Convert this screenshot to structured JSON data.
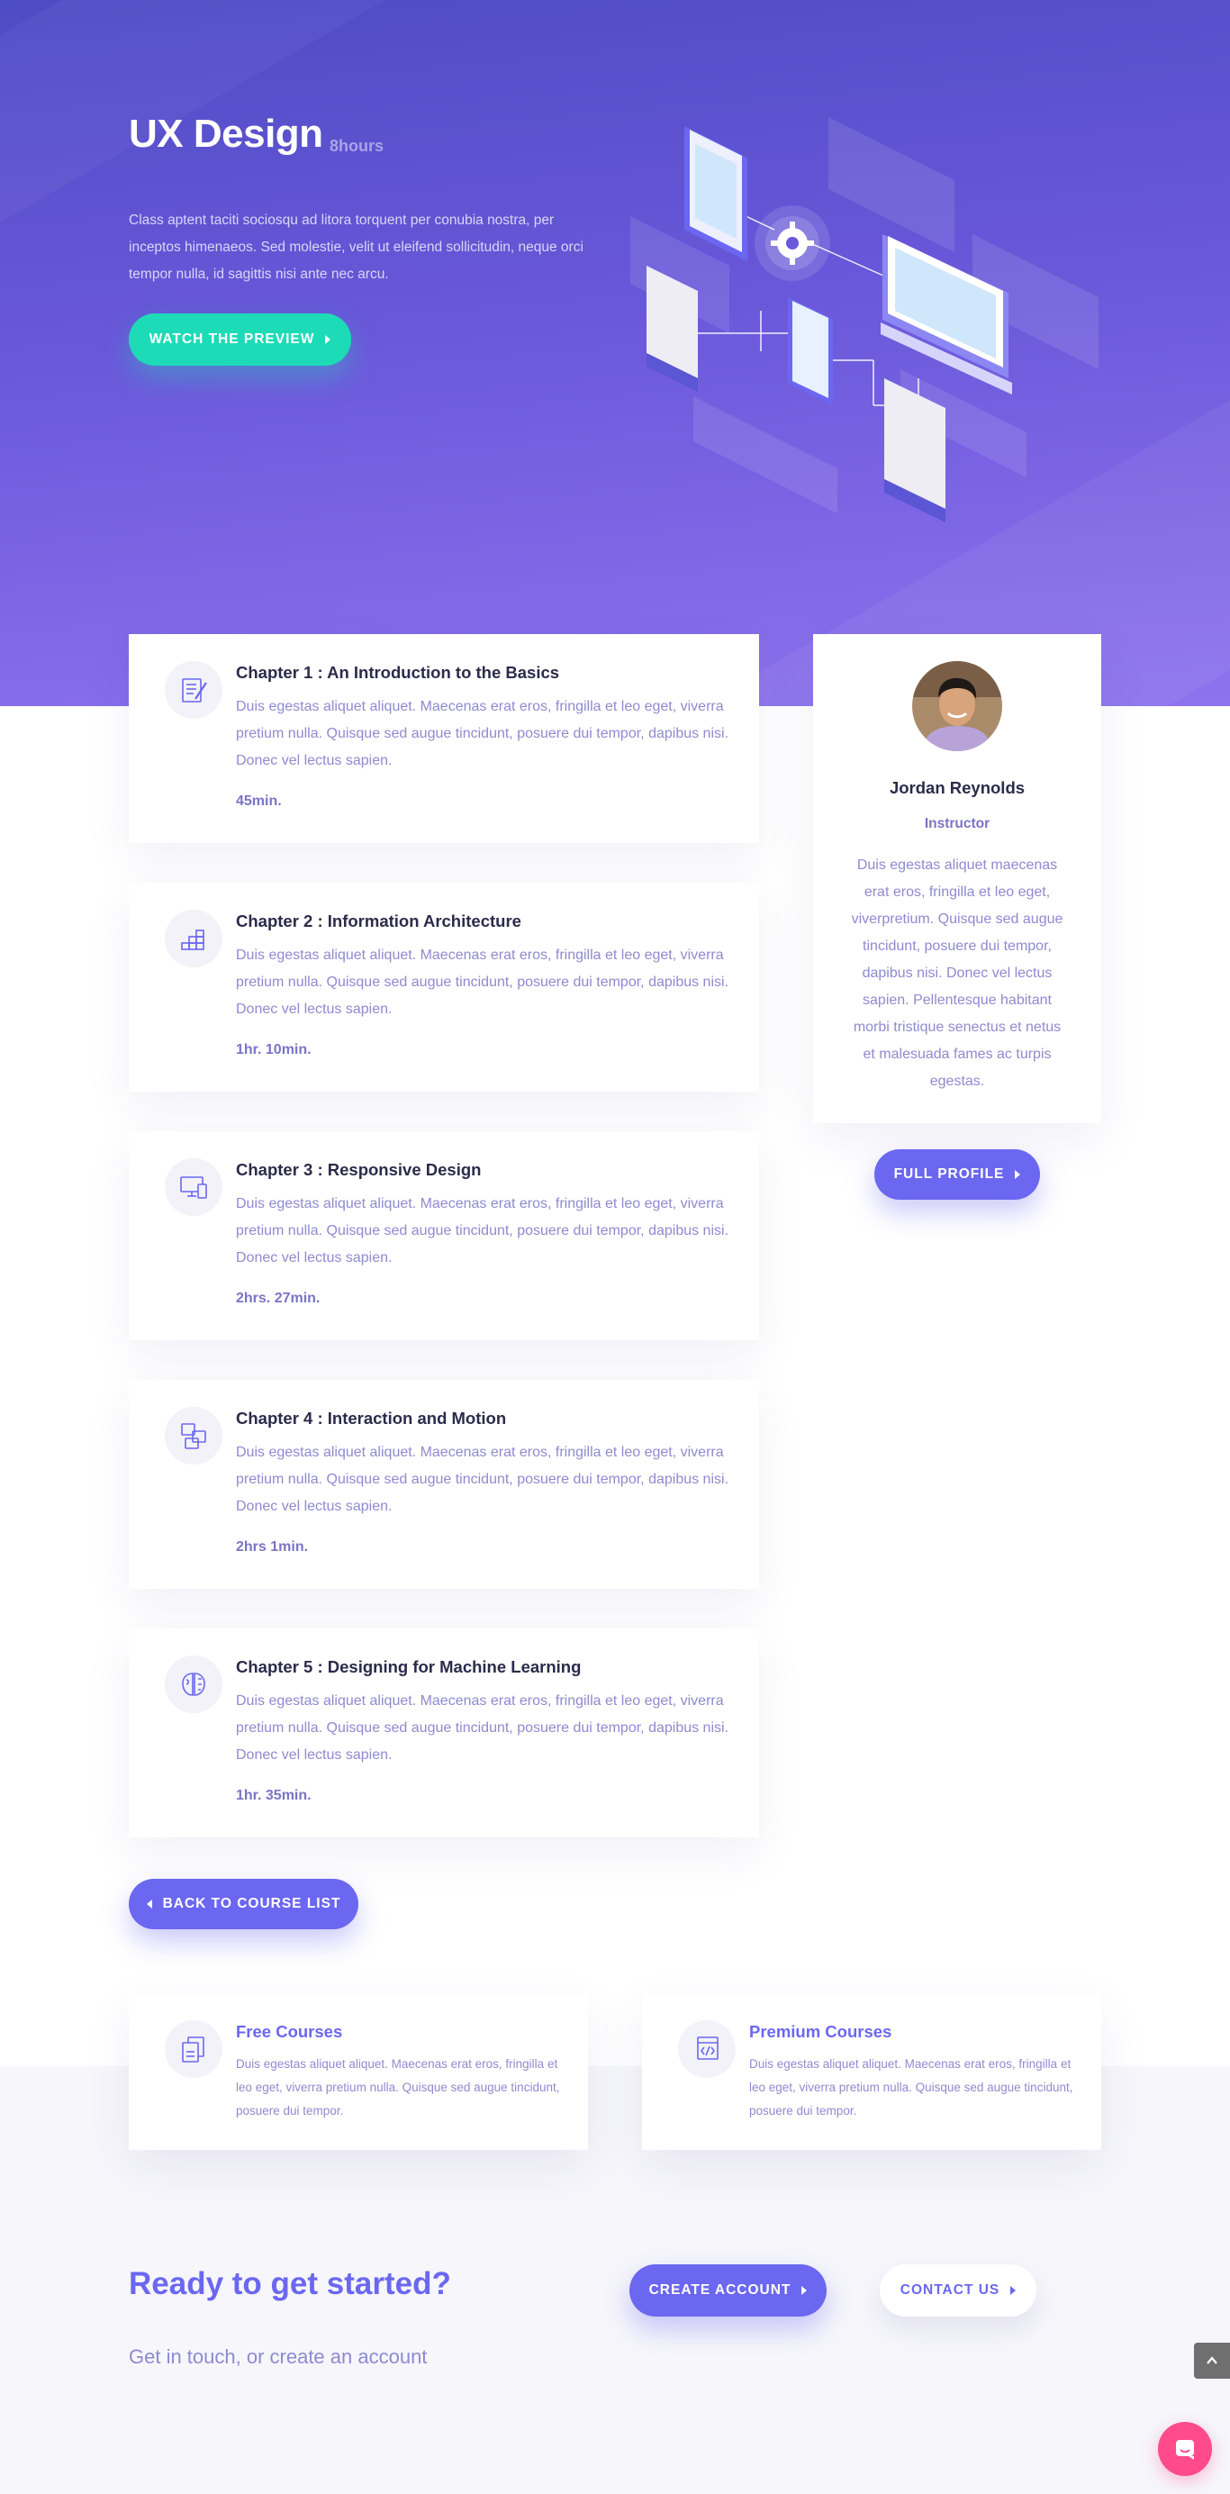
{
  "hero": {
    "title": "UX Design",
    "hours": "8hours",
    "description": "Class aptent taciti sociosqu ad litora torquent per conubia nostra, per inceptos himenaeos. Sed molestie, velit ut eleifend sollicitudin, neque orci tempor nulla, id sagittis nisi ante nec arcu.",
    "cta_label": "Watch the Preview"
  },
  "chapters": [
    {
      "title": "Chapter 1 : An Introduction to the Basics",
      "text": "Duis egestas aliquet aliquet. Maecenas erat eros, fringilla et leo eget, viverra pretium nulla. Quisque sed augue tincidunt, posuere dui tempor, dapibus nisi. Donec vel lectus sapien.",
      "duration": "45min.",
      "icon": "checklist-pencil-icon"
    },
    {
      "title": "Chapter 2 : Information Architecture",
      "text": "Duis egestas aliquet aliquet. Maecenas erat eros, fringilla et leo eget, viverra pretium nulla. Quisque sed augue tincidunt, posuere dui tempor, dapibus nisi. Donec vel lectus sapien.",
      "duration": "1hr. 10min.",
      "icon": "blocks-stack-icon"
    },
    {
      "title": "Chapter 3 : Responsive Design",
      "text": "Duis egestas aliquet aliquet. Maecenas erat eros, fringilla et leo eget, viverra pretium nulla. Quisque sed augue tincidunt, posuere dui tempor, dapibus nisi. Donec vel lectus sapien.",
      "duration": "2hrs. 27min.",
      "icon": "devices-icon"
    },
    {
      "title": "Chapter 4 : Interaction and Motion",
      "text": "Duis egestas aliquet aliquet. Maecenas erat eros, fringilla et leo eget, viverra pretium nulla. Quisque sed augue tincidunt, posuere dui tempor, dapibus nisi. Donec vel lectus sapien.",
      "duration": "2hrs 1min.",
      "icon": "interaction-icon"
    },
    {
      "title": "Chapter 5 : Designing for Machine Learning",
      "text": "Duis egestas aliquet aliquet. Maecenas erat eros, fringilla et leo eget, viverra pretium nulla. Quisque sed augue tincidunt, posuere dui tempor, dapibus nisi. Donec vel lectus sapien.",
      "duration": "1hr. 35min.",
      "icon": "brain-icon"
    }
  ],
  "instructor": {
    "name": "Jordan Reynolds",
    "role": "Instructor",
    "bio": "Duis egestas aliquet maecenas erat eros, fringilla et leo eget, viverpretium. Quisque sed augue tincidunt, posuere dui tempor, dapibus nisi. Donec vel lectus sapien. Pellentesque habitant morbi tristique senectus et netus et malesuada fames ac turpis egestas.",
    "profile_label": "Full Profile"
  },
  "back_label": "Back to Course List",
  "course_types": [
    {
      "title": "Free Courses",
      "text": "Duis egestas aliquet aliquet. Maecenas erat eros, fringilla et leo eget, viverra pretium nulla. Quisque sed augue tincidunt, posuere dui tempor.",
      "icon": "documents-icon"
    },
    {
      "title": "Premium Courses",
      "text": "Duis egestas aliquet aliquet. Maecenas erat eros, fringilla et leo eget, viverra pretium nulla. Quisque sed augue tincidunt, posuere dui tempor.",
      "icon": "code-window-icon"
    }
  ],
  "cta": {
    "title": "Ready to get started?",
    "subtitle": "Get in touch, or create an account",
    "create_label": "Create Account",
    "contact_label": "Contact Us"
  },
  "colors": {
    "accent": "#6b67f0",
    "teal": "#1ddbb6",
    "text_muted": "#8f8ad0",
    "chat": "#ff4b8a"
  }
}
